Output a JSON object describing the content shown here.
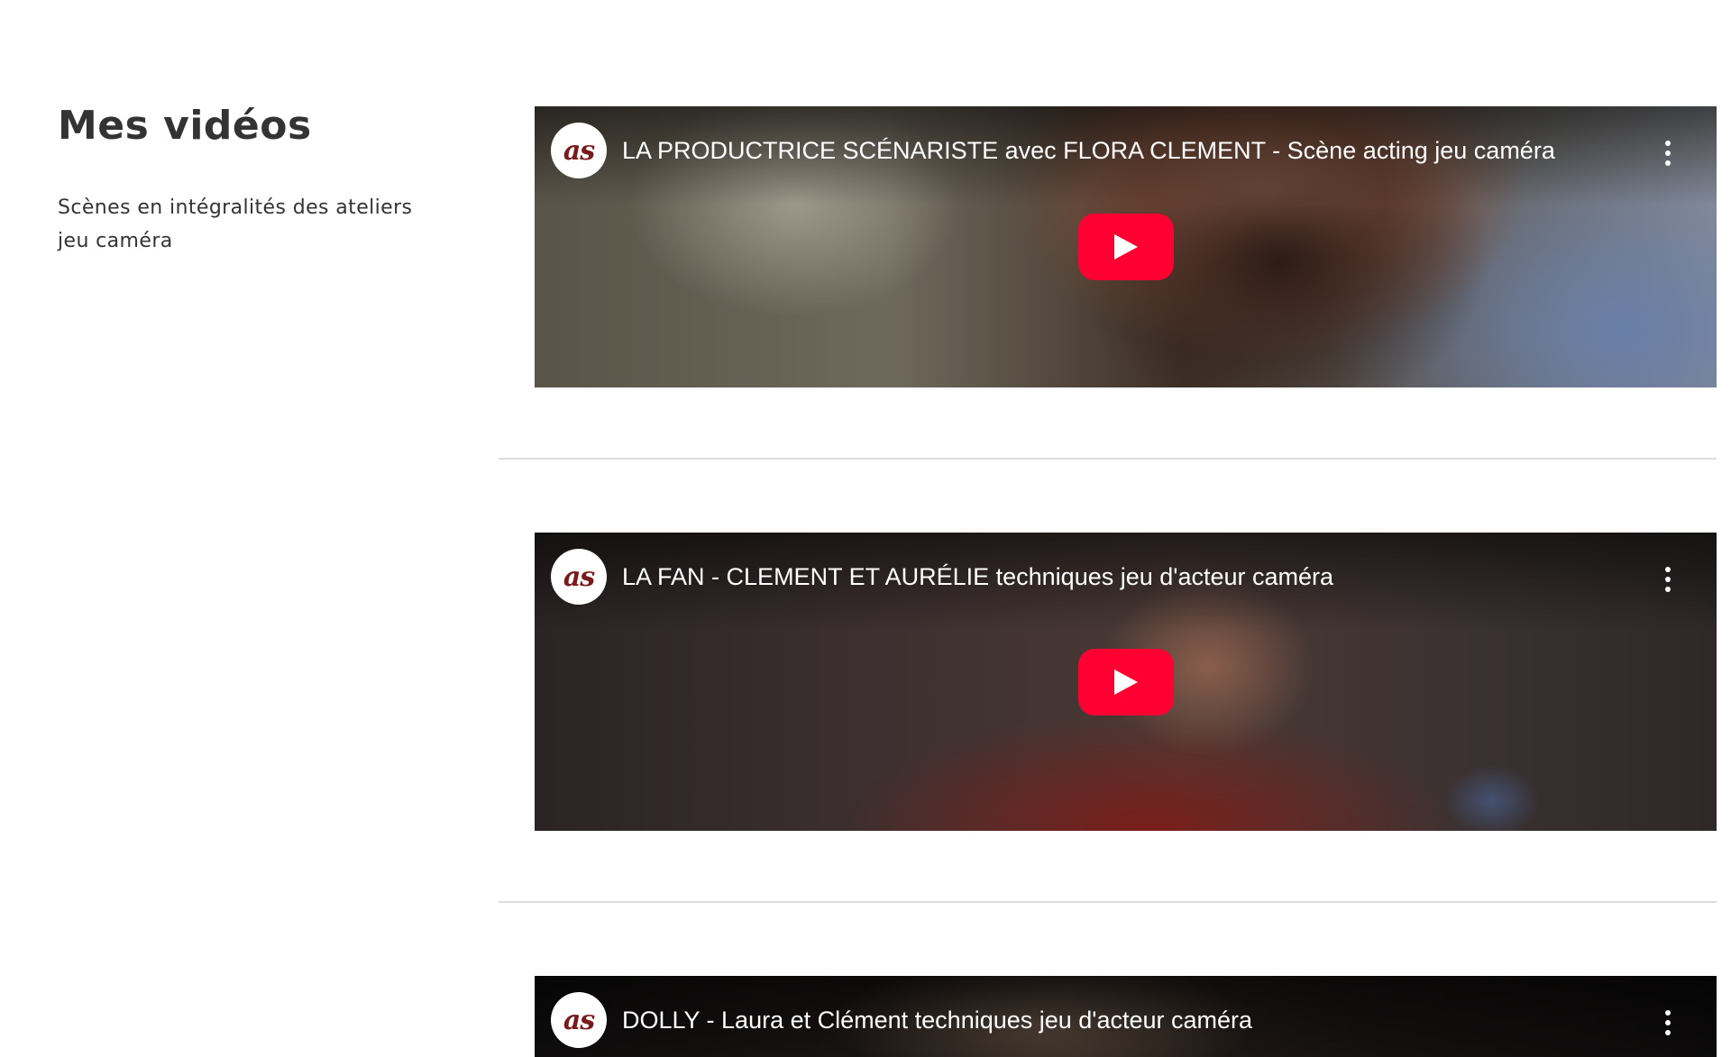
{
  "sidebar": {
    "title": "Mes vidéos",
    "subtitle_line1": "Scènes en intégralités des ateliers",
    "subtitle_line2": "jeu caméra"
  },
  "videos": [
    {
      "title": "LA PRODUCTRICE SCÉNARISTE avec FLORA CLEMENT - Scène acting jeu caméra",
      "channel_logo": "as",
      "icons": [
        "channel-logo",
        "more-options-icon",
        "play-icon"
      ]
    },
    {
      "title": "LA FAN - CLEMENT ET AURÉLIE techniques jeu d'acteur caméra",
      "channel_logo": "as",
      "icons": [
        "channel-logo",
        "more-options-icon",
        "play-icon"
      ]
    },
    {
      "title": "DOLLY - Laura et Clément techniques jeu d'acteur caméra",
      "channel_logo": "as",
      "icons": [
        "channel-logo",
        "more-options-icon"
      ]
    }
  ],
  "colors": {
    "play_button": "#ff0033",
    "divider": "#dddddd",
    "text": "#333333"
  }
}
